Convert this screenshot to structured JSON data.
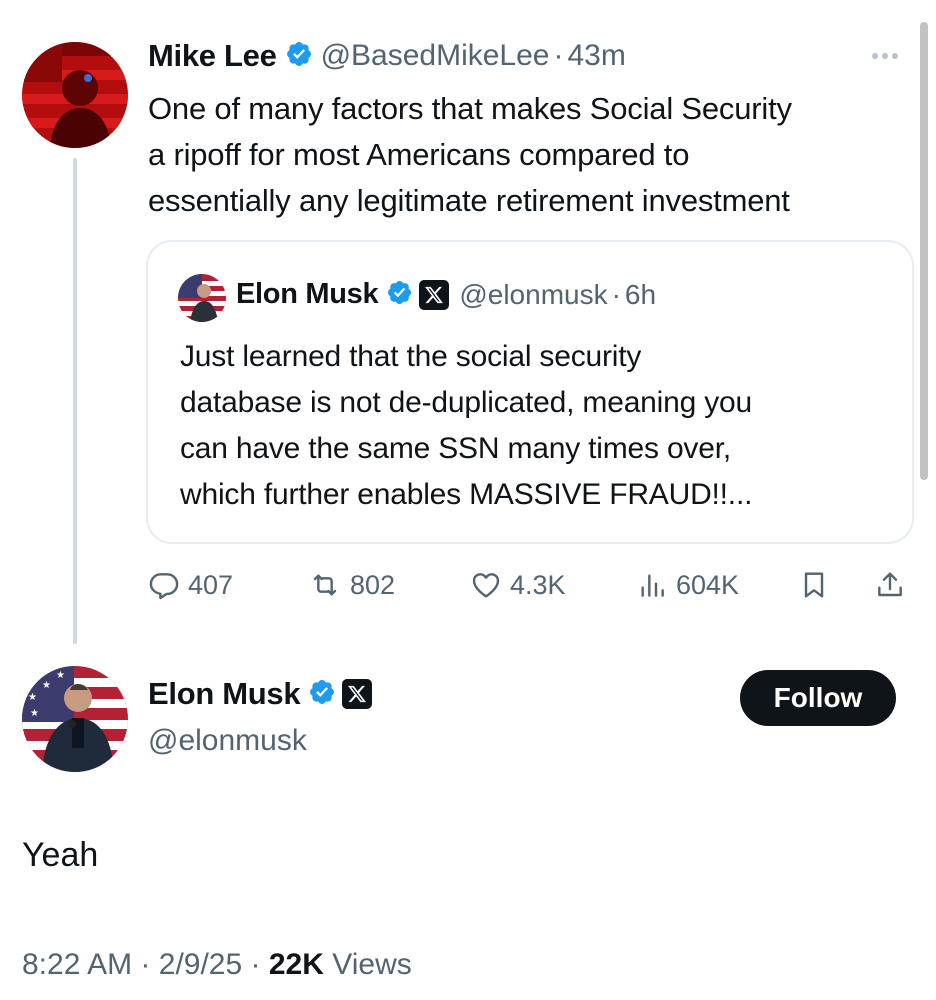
{
  "parent_tweet": {
    "author_name": "Mike Lee",
    "handle": "@BasedMikeLee",
    "separator": "·",
    "time": "43m",
    "text_lines": [
      "One of many factors that makes Social Security",
      "a ripoff for most Americans compared to",
      "essentially any legitimate retirement investment"
    ],
    "avatar_icon": "red-flag-portrait-avatar",
    "more_icon": "ellipsis-icon"
  },
  "quoted_tweet": {
    "author_name": "Elon Musk",
    "handle": "@elonmusk",
    "separator": "·",
    "time": "6h",
    "text_lines": [
      "Just learned that the social security",
      "database is not de-duplicated, meaning you",
      "can have the same SSN many times over,",
      "which further enables MASSIVE FRAUD!!..."
    ]
  },
  "actions": {
    "replies": "407",
    "reposts": "802",
    "likes": "4.3K",
    "views": "604K"
  },
  "reply_tweet": {
    "author_name": "Elon Musk",
    "handle": "@elonmusk",
    "follow_label": "Follow",
    "text": "Yeah",
    "time": "8:22 AM",
    "separator": "·",
    "date": "2/9/25",
    "views_count": "22K",
    "views_label": "Views"
  },
  "colors": {
    "text": "#0f1419",
    "secondary": "#536471",
    "verified_blue": "#1d9bf0",
    "border": "#e6ecf0",
    "thread_line": "#cfd9de"
  }
}
